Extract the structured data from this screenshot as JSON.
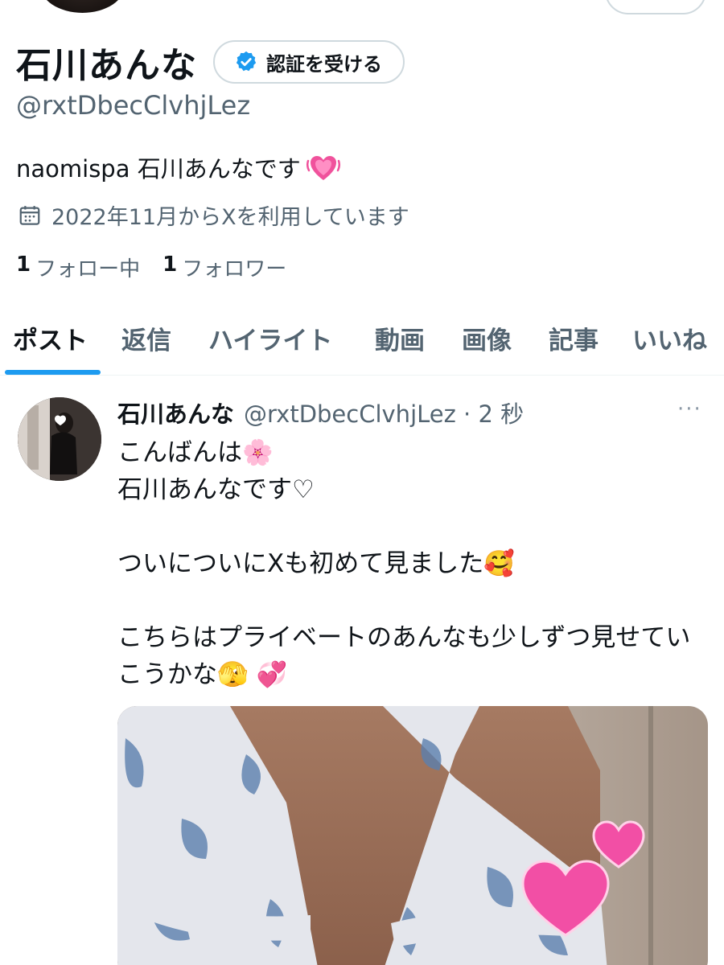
{
  "profile": {
    "display_name": "石川あんな",
    "verify_label": "認証を受ける",
    "handle": "@rxtDbecClvhjLez",
    "bio": "naomispa 石川あんなです",
    "joined": "2022年11月からXを利用しています",
    "following_count": "1",
    "following_label": "フォロー中",
    "followers_count": "1",
    "followers_label": "フォロワー"
  },
  "tabs": [
    "ポスト",
    "返信",
    "ハイライト",
    "動画",
    "画像",
    "記事",
    "いいね"
  ],
  "post": {
    "name": "石川あんな",
    "handle_time": "@rxtDbecClvhjLez · 2 秒",
    "more": "···",
    "text": "こんばんは🌸\n石川あんなです♡\n\nついについにXも初めて見ました🥰\n\nこちらはプライベートのあんなも少しずつ見せていこうかな🫣 💞"
  },
  "colors": {
    "accent": "#1d9bf0",
    "secondary_text": "#536471",
    "primary_text": "#0f1419",
    "border": "#cfd9de"
  },
  "icons": [
    "verified-badge-icon",
    "calendar-icon",
    "sparkling-heart-icon",
    "more-dots-icon"
  ]
}
